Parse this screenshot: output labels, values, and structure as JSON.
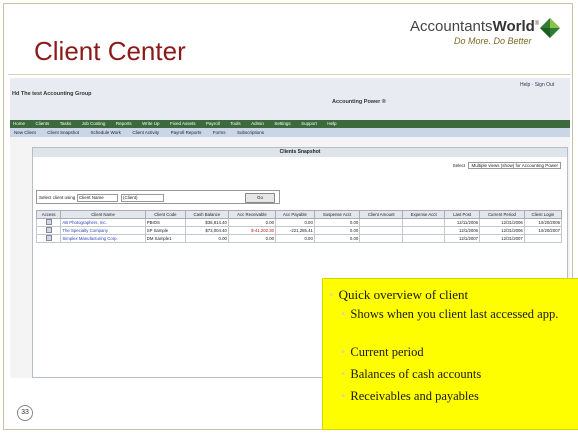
{
  "slide": {
    "title": "Client Center",
    "number": "33",
    "logo": {
      "brand_light": "Accountants",
      "brand_bold": "World",
      "reg": "®",
      "tagline": "Do More. Do Better"
    }
  },
  "app": {
    "firm_name": "Hd The test Accounting Group",
    "app_name": "Accounting Power ®",
    "top_links": "Help · Sign Out",
    "menu": [
      "Home",
      "Clients",
      "Tasks",
      "Job Costing",
      "Reports",
      "Write Up",
      "Fixed Assets",
      "Payroll",
      "Tools",
      "Admin",
      "Settings",
      "Support",
      "Help"
    ],
    "toolbar": [
      "New Client",
      "Client Snapshot",
      "Schedule Work",
      "Client Activity",
      "Payroll Reports",
      "Forms",
      "Subscriptions"
    ],
    "panel_title": "Clients Snapshot",
    "select_label": "Select",
    "select_value": "Multiple views (show) for Accounting Power",
    "filter": {
      "label": "Select client using",
      "dropdown": "Client Name",
      "input_value": "(Client)",
      "button": "Go"
    },
    "table": {
      "columns": [
        "Access",
        "Client Name",
        "Client Code",
        "Cash Balance",
        "Acc Receivable",
        "Acc Payable",
        "Suspense Acct",
        "Client Amount",
        "Expense Acct",
        "Last Post",
        "Current Period",
        "Client Login"
      ],
      "rows": [
        [
          "",
          "AB Photographers, Inc.",
          "PBIOS",
          "$36,814.40",
          "0.00",
          "0.00",
          "0.00",
          "",
          "",
          "12/11/2006",
          "12/31/2006",
          "10/20/2006"
        ],
        [
          "",
          "The Specialty Company",
          "SP Sample",
          "$73,004.40",
          "$-41,202.30",
          "-221,285.41",
          "0.00",
          "",
          "",
          "12/1/2006",
          "12/31/2006",
          "10/20/2007"
        ],
        [
          "",
          "Simplex Manufacturing Corp.",
          "DM Sample1",
          "0.00",
          "0.00",
          "0.00",
          "0.00",
          "",
          "",
          "12/1/2007",
          "12/31/2007",
          ""
        ]
      ]
    }
  },
  "callout": {
    "heading": "Quick overview of client",
    "items": [
      "Shows when you client last accessed app.",
      "Current period",
      "Balances of cash accounts",
      "Receivables and payables"
    ]
  },
  "colors": {
    "title": "#8b1a1a",
    "callout": "#fefe00",
    "menubar": "#3d6a3d"
  }
}
